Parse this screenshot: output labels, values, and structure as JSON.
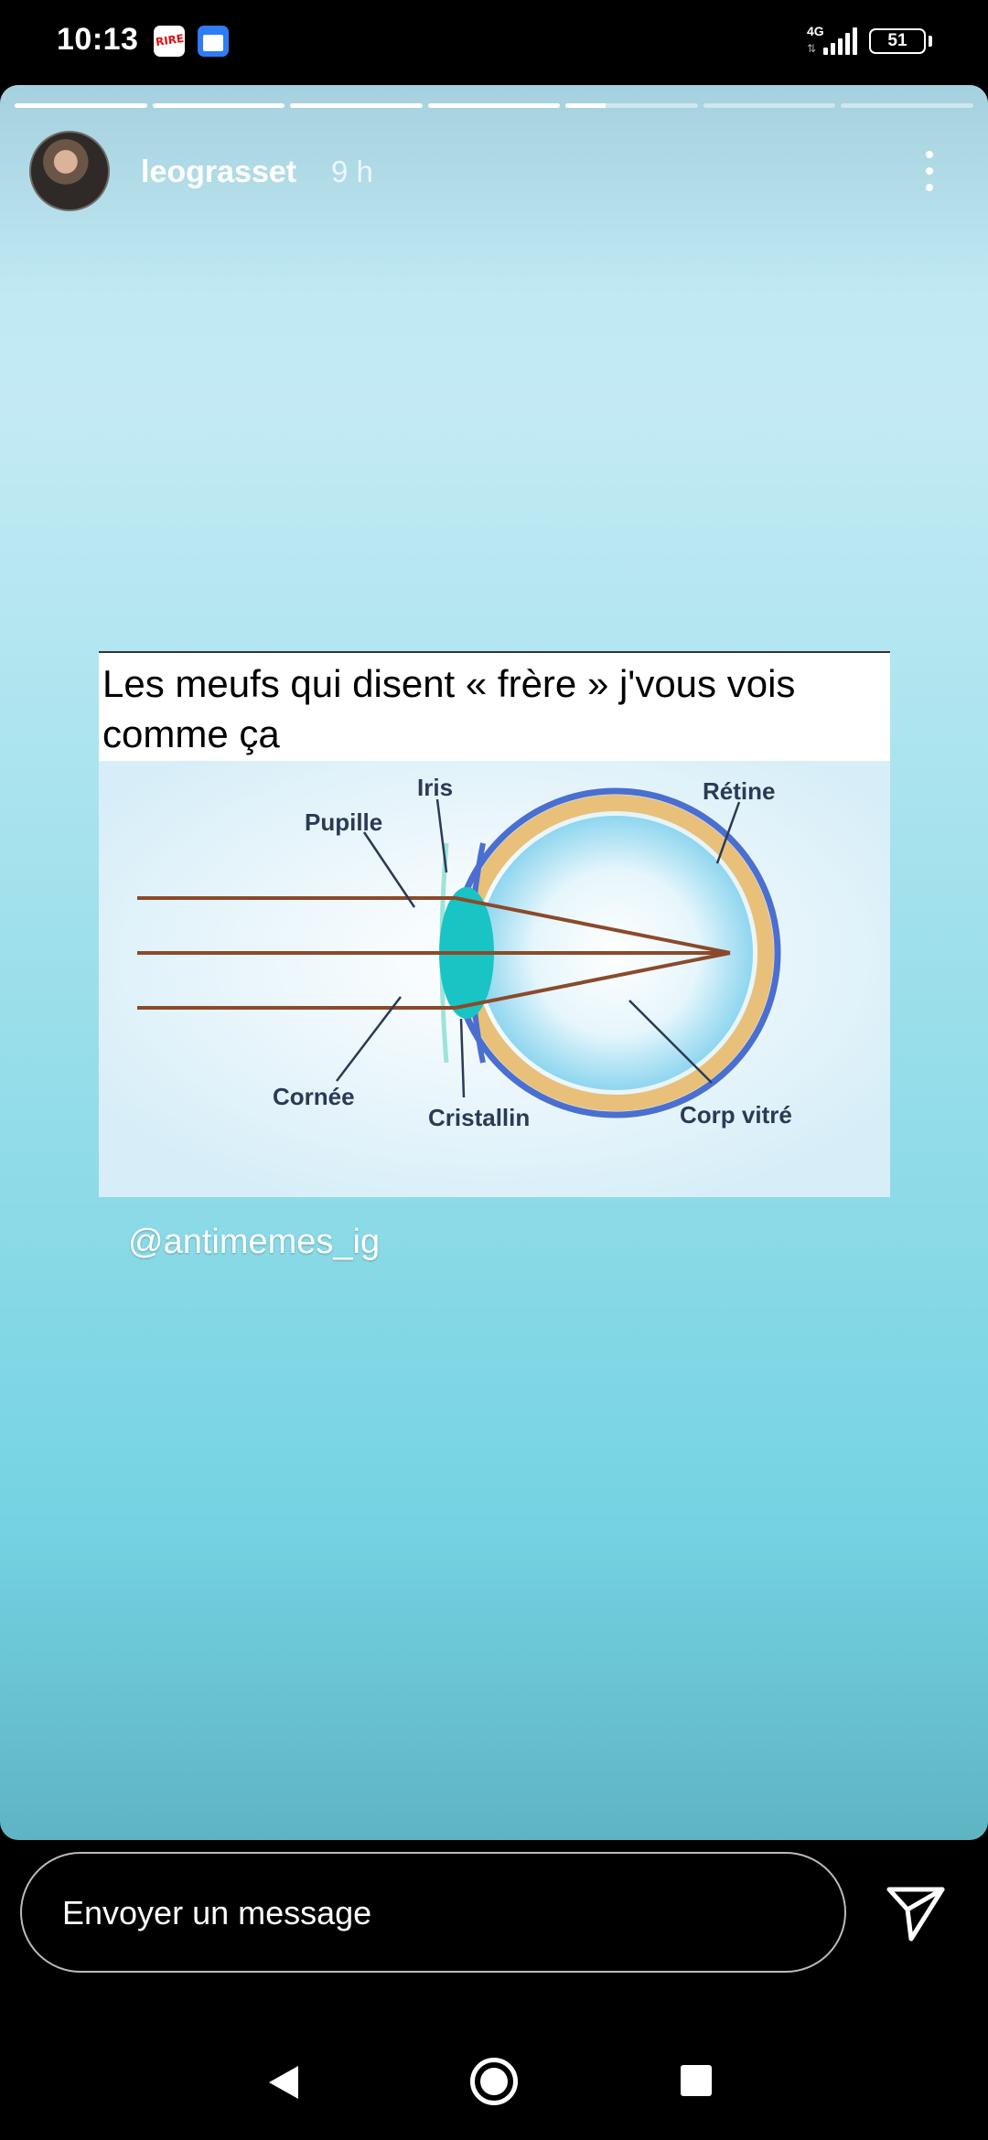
{
  "status_bar": {
    "time": "10:13",
    "network": "4G",
    "battery": "51",
    "notification_icons": [
      "rire-app-icon",
      "calendar-icon"
    ]
  },
  "story": {
    "username": "leograsset",
    "time_ago": "9 h",
    "progress": {
      "segments": 7,
      "completed": 4,
      "current_fraction": 0.3
    },
    "meme": {
      "caption": "Les meufs qui disent « frère » j'vous vois comme ça",
      "labels": {
        "iris": "Iris",
        "retine": "Rétine",
        "pupille": "Pupille",
        "cornee": "Cornée",
        "cristallin": "Cristallin",
        "corp_vitre": "Corp vitré"
      }
    },
    "mention": "@antimemes_ig"
  },
  "message_bar": {
    "placeholder": "Envoyer un message"
  },
  "colors": {
    "story_top": "#b9e7f2",
    "story_bottom": "#5fb4c4",
    "ray": "#8a4a2a",
    "eye_outline": "#4a6fd0",
    "eye_band": "#e8c07a",
    "lens": "#19c4c4"
  }
}
